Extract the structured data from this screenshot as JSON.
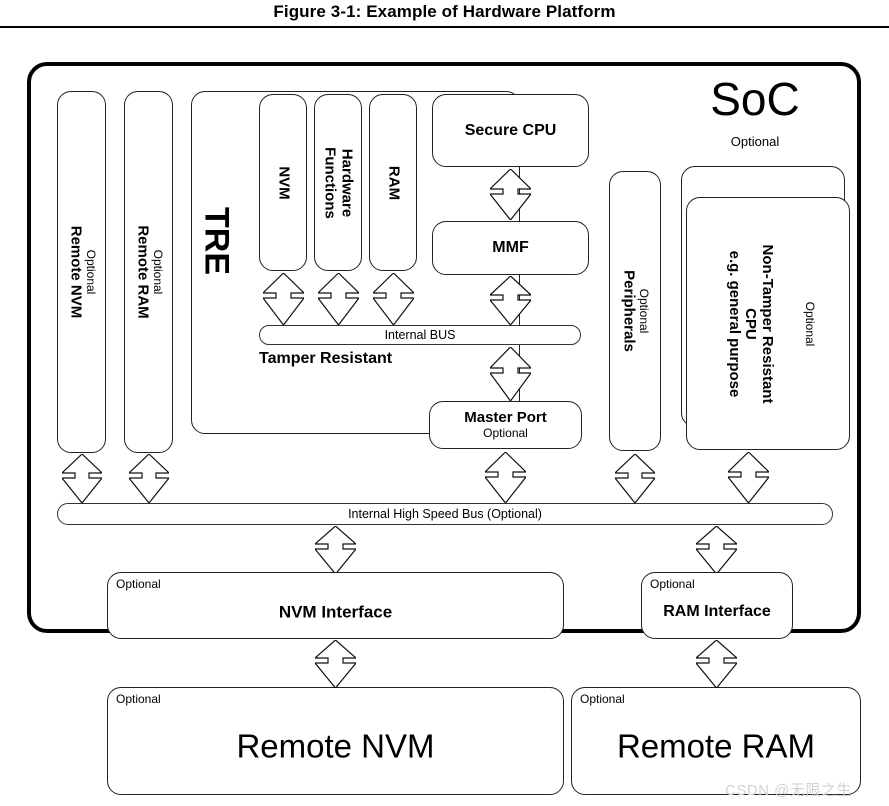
{
  "figure": {
    "title": "Figure 3-1:  Example of Hardware Platform"
  },
  "soc": {
    "label": "SoC",
    "optional": "Optional"
  },
  "optional_label": "Optional",
  "blocks": {
    "remote_nvm_left": {
      "label": "Remote NVM",
      "optional": "Optional"
    },
    "remote_ram_left": {
      "label": "Remote RAM",
      "optional": "Optional"
    },
    "tre": {
      "label": "TRE"
    },
    "nvm": {
      "label": "NVM"
    },
    "hardware_functions": {
      "label": "Hardware\nFunctions",
      "line1": "Hardware",
      "line2": "Functions"
    },
    "ram": {
      "label": "RAM"
    },
    "secure_cpu": {
      "label": "Secure CPU"
    },
    "mmf": {
      "label": "MMF"
    },
    "master_port": {
      "label": "Master Port",
      "optional": "Optional"
    },
    "peripherals": {
      "label": "Peripherals",
      "optional": "Optional"
    },
    "non_tamper_cpu": {
      "line1": "Non-Tamper Resistant",
      "line2": "CPU",
      "line3": "e.g. general purpose",
      "optional": "Optional"
    },
    "nvm_interface": {
      "label": "NVM Interface",
      "optional": "Optional"
    },
    "ram_interface": {
      "label": "RAM Interface",
      "optional": "Optional"
    },
    "remote_nvm_bottom": {
      "label": "Remote NVM",
      "optional": "Optional"
    },
    "remote_ram_bottom": {
      "label": "Remote RAM",
      "optional": "Optional"
    }
  },
  "buses": {
    "internal_bus": {
      "label": "Internal BUS"
    },
    "internal_high_speed_bus": {
      "label": "Internal High Speed Bus (Optional)"
    }
  },
  "annotations": {
    "tamper_resistant": "Tamper Resistant"
  },
  "watermark": {
    "text": "CSDN @无限之生"
  },
  "colors": {
    "stroke": "#222222",
    "thick_stroke": "#000000",
    "background": "#ffffff",
    "watermark": "#d2d2d2"
  },
  "arrows": {
    "kind": "double-headed-vertical",
    "count": 16
  }
}
